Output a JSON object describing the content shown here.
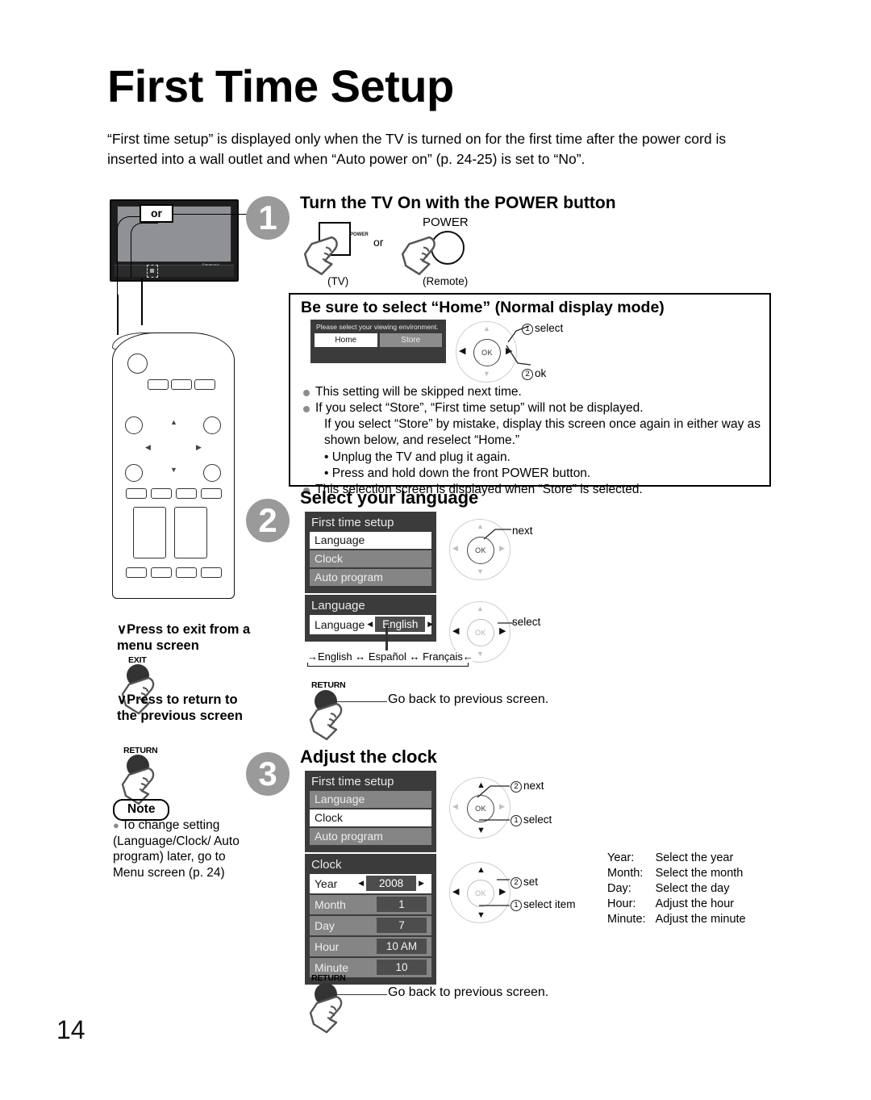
{
  "page": {
    "title": "First Time Setup",
    "intro": "“First time setup” is displayed only when the TV is turned on for the first time after the power cord is inserted into a wall outlet and when “Auto power on” (p. 24-25) is set to “No”.",
    "number": "14"
  },
  "tv_illustration": {
    "or_badge": "or",
    "brand": "Panasonic"
  },
  "step1": {
    "number": "1",
    "heading": "Turn the TV On with the POWER button",
    "tv_button_label": "POWER",
    "or_text": "or",
    "remote_button_label": "POWER",
    "tv_caption": "(TV)",
    "remote_caption": "(Remote)"
  },
  "home_box": {
    "heading": "Be sure to select “Home” (Normal display mode)",
    "osd": {
      "title": "Please select your viewing environment.",
      "button_home": "Home",
      "button_store": "Store"
    },
    "callouts": {
      "select": "select",
      "select_num": "①",
      "ok": "ok",
      "ok_num": "②"
    },
    "bullets": [
      "This setting will be skipped next time.",
      "If you select “Store”, “First time setup” will not be displayed.",
      "If you select “Store” by mistake, display this screen once again in either way as shown below, and reselect “Home.”",
      "• Unplug the TV and plug it again.",
      "• Press and hold down the front POWER button.",
      "This selection screen is displayed when “Store” is selected."
    ]
  },
  "step2": {
    "number": "2",
    "heading": "Select your language",
    "osd_first_time_setup": {
      "title": "First time setup",
      "rows": [
        {
          "label": "Language",
          "selected": true
        },
        {
          "label": "Clock",
          "selected": false
        },
        {
          "label": "Auto program",
          "selected": false
        }
      ]
    },
    "callout_next": "next",
    "osd_language": {
      "title": "Language",
      "row_label": "Language",
      "row_value": "English"
    },
    "callout_select": "select",
    "language_cycle": "→English ↔ Español ↔ Français←",
    "return": {
      "key_label": "RETURN",
      "text": "Go back to previous screen."
    }
  },
  "step3": {
    "number": "3",
    "heading": "Adjust the clock",
    "osd_first_time_setup": {
      "title": "First time setup",
      "rows": [
        {
          "label": "Language",
          "selected": false
        },
        {
          "label": "Clock",
          "selected": true
        },
        {
          "label": "Auto program",
          "selected": false
        }
      ]
    },
    "callout_next": "next",
    "callout_next_num": "②",
    "callout_select": "select",
    "callout_select_num": "①",
    "osd_clock": {
      "title": "Clock",
      "rows": [
        {
          "label": "Year",
          "value": "2008",
          "selected": true
        },
        {
          "label": "Month",
          "value": "1",
          "selected": false
        },
        {
          "label": "Day",
          "value": "7",
          "selected": false
        },
        {
          "label": "Hour",
          "value": "10 AM",
          "selected": false
        },
        {
          "label": "Minute",
          "value": "10",
          "selected": false
        }
      ]
    },
    "callout_set": "set",
    "callout_set_num": "②",
    "callout_select_item": "select item",
    "callout_select_item_num": "①",
    "legend": [
      {
        "key": "Year:",
        "desc": "Select the year"
      },
      {
        "key": "Month:",
        "desc": "Select the month"
      },
      {
        "key": "Day:",
        "desc": "Select the day"
      },
      {
        "key": "Hour:",
        "desc": "Adjust the hour"
      },
      {
        "key": "Minute:",
        "desc": "Adjust the minute"
      }
    ],
    "return": {
      "key_label": "RETURN",
      "text": "Go back to previous screen."
    }
  },
  "sidebar": {
    "exit_note": "Press to exit from a menu screen",
    "exit_key_label": "EXIT",
    "return_note": "Press to return to the previous screen",
    "return_key_label": "RETURN",
    "note_badge": "Note",
    "note_text": "To change setting (Language/Clock/ Auto program) later, go to Menu screen (p. 24)"
  },
  "remote_illustration": {
    "ok_label": "OK"
  },
  "colors": {
    "osd_bg": "#3b3b3b",
    "osd_selected_bg": "#ffffff",
    "osd_unselected_bg": "#858585",
    "osd_value_bg": "#4d4d4d",
    "step_circle_bg": "#9a9a9a",
    "bullet": "#8d8d8d",
    "key_dot": "#333333"
  }
}
